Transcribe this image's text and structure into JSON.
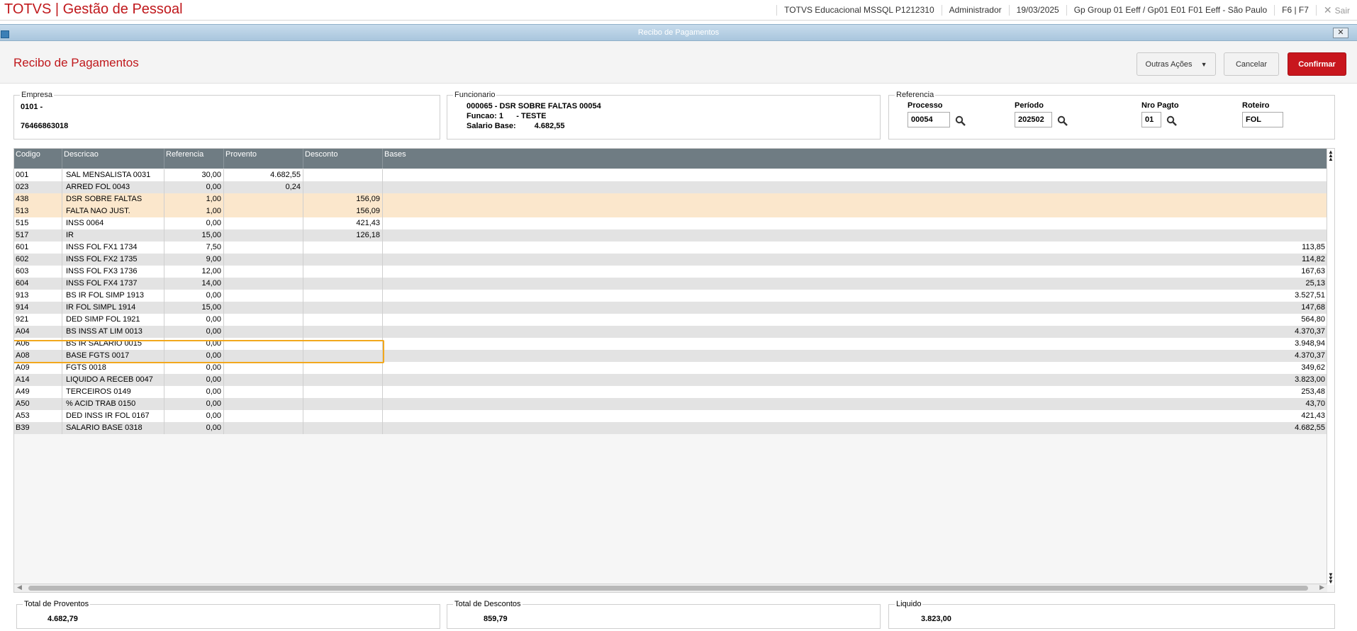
{
  "topbar": {
    "app_title": "TOTVS | Gestão de Pessoal",
    "environment": "TOTVS Educacional MSSQL P1212310",
    "user": "Administrador",
    "date": "19/03/2025",
    "group": "Gp Group 01 Eeff / Gp01 E01 F01 Eeff - São Paulo",
    "shortcuts": "F6 | F7",
    "exit_label": "Sair"
  },
  "window": {
    "title": "Recibo de Pagamentos"
  },
  "header": {
    "page_title": "Recibo de Pagamentos",
    "outras_label": "Outras Ações",
    "cancel_label": "Cancelar",
    "confirm_label": "Confirmar"
  },
  "empresa": {
    "legend": "Empresa",
    "code": "0101 -",
    "number": "76466863018"
  },
  "funcionario": {
    "legend": "Funcionario",
    "line1": "000065 - DSR SOBRE FALTAS 00054",
    "line2": "Funcao: 1      - TESTE",
    "salario_label": "Salario Base:",
    "salario_value": "4.682,55"
  },
  "referencia": {
    "legend": "Referencia",
    "processo_label": "Processo",
    "processo_value": "00054",
    "periodo_label": "Período",
    "periodo_value": "202502",
    "nropagto_label": "Nro Pagto",
    "nropagto_value": "01",
    "roteiro_label": "Roteiro",
    "roteiro_value": "FOL"
  },
  "grid": {
    "columns": [
      "Codigo",
      "Descricao",
      "Referencia",
      "Provento",
      "Desconto",
      "Bases"
    ],
    "rows": [
      [
        "001",
        "SAL MENSALISTA 0031",
        "30,00",
        "4.682,55",
        "",
        ""
      ],
      [
        "023",
        "ARRED FOL 0043",
        "0,00",
        "0,24",
        "",
        ""
      ],
      [
        "438",
        "DSR SOBRE FALTAS",
        "1,00",
        "",
        "156,09",
        ""
      ],
      [
        "513",
        "FALTA NAO JUST.",
        "1,00",
        "",
        "156,09",
        ""
      ],
      [
        "515",
        "INSS 0064",
        "0,00",
        "",
        "421,43",
        ""
      ],
      [
        "517",
        "IR",
        "15,00",
        "",
        "126,18",
        ""
      ],
      [
        "601",
        "INSS FOL FX1 1734",
        "7,50",
        "",
        "",
        "113,85"
      ],
      [
        "602",
        "INSS FOL FX2 1735",
        "9,00",
        "",
        "",
        "114,82"
      ],
      [
        "603",
        "INSS FOL FX3 1736",
        "12,00",
        "",
        "",
        "167,63"
      ],
      [
        "604",
        "INSS FOL FX4 1737",
        "14,00",
        "",
        "",
        "25,13"
      ],
      [
        "913",
        "BS IR FOL SIMP 1913",
        "0,00",
        "",
        "",
        "3.527,51"
      ],
      [
        "914",
        "IR FOL SIMPL 1914",
        "15,00",
        "",
        "",
        "147,68"
      ],
      [
        "921",
        "DED SIMP FOL 1921",
        "0,00",
        "",
        "",
        "564,80"
      ],
      [
        "A04",
        "BS INSS AT LIM 0013",
        "0,00",
        "",
        "",
        "4.370,37"
      ],
      [
        "A06",
        "BS IR SALARIO 0015",
        "0,00",
        "",
        "",
        "3.948,94"
      ],
      [
        "A08",
        "BASE FGTS 0017",
        "0,00",
        "",
        "",
        "4.370,37"
      ],
      [
        "A09",
        "FGTS 0018",
        "0,00",
        "",
        "",
        "349,62"
      ],
      [
        "A14",
        "LIQUIDO A RECEB 0047",
        "0,00",
        "",
        "",
        "3.823,00"
      ],
      [
        "A49",
        "TERCEIROS 0149",
        "0,00",
        "",
        "",
        "253,48"
      ],
      [
        "A50",
        "% ACID TRAB 0150",
        "0,00",
        "",
        "",
        "43,70"
      ],
      [
        "A53",
        "DED INSS IR FOL 0167",
        "0,00",
        "",
        "",
        "421,43"
      ],
      [
        "B39",
        "SALARIO BASE 0318",
        "0,00",
        "",
        "",
        "4.682,55"
      ]
    ],
    "highlighted_codes": [
      "438",
      "513"
    ]
  },
  "totals": {
    "proventos_label": "Total de Proventos",
    "proventos_value": "4.682,79",
    "descontos_label": "Total de Descontos",
    "descontos_value": "859,79",
    "liquido_label": "Liquido",
    "liquido_value": "3.823,00"
  },
  "colors": {
    "brand_red": "#c0181c",
    "header_gray": "#6f7c83",
    "highlight": "#f2a81d"
  }
}
